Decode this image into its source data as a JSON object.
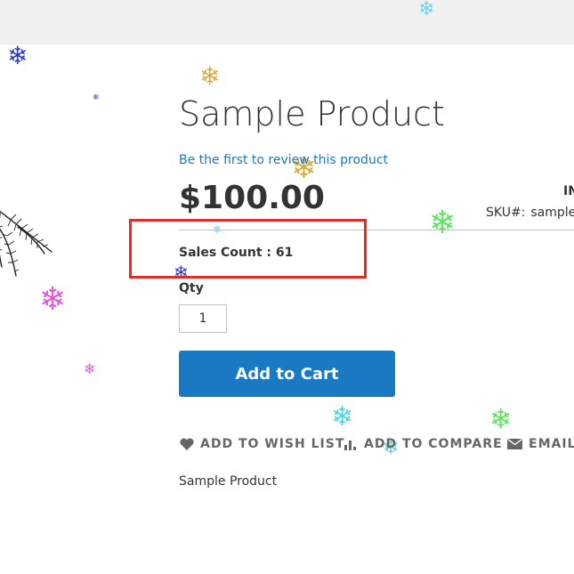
{
  "product": {
    "title": "Sample Product",
    "review_link": "Be the first to review this product",
    "price": "$100.00",
    "stock_status": "IN",
    "sku_label": "SKU#:",
    "sku_value": "sample-",
    "sales_count": "Sales Count : 61",
    "qty_label": "Qty",
    "qty_value": "1",
    "add_to_cart_label": "Add to Cart",
    "description": "Sample Product"
  },
  "actions": {
    "wishlist": "ADD TO WISH LIST",
    "compare": "ADD TO COMPARE",
    "email": "EMAIL"
  },
  "colors": {
    "accent": "#1979c3",
    "highlight_box": "#e02b27",
    "topbar": "#f0f0f0"
  }
}
